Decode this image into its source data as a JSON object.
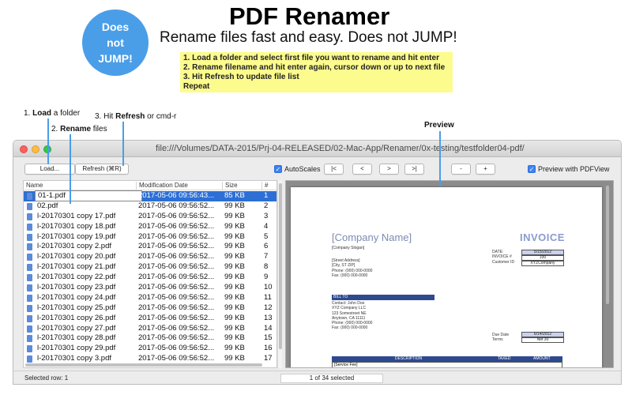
{
  "marketing": {
    "badge_lines": [
      "Does",
      "not",
      "JUMP!"
    ],
    "title": "PDF Renamer",
    "subtitle": "Rename files fast and easy. Does not JUMP!",
    "steps": [
      "1. Load a folder and select first file you want to rename and hit enter",
      "2. Rename filename and hit enter again, cursor down or up to next file",
      "3. Hit Refresh to update file list",
      "Repeat"
    ],
    "callouts": {
      "load_prefix": "1. ",
      "load_bold": "Load",
      "load_suffix": " a folder",
      "rename_prefix": "2. ",
      "rename_bold": "Rename",
      "rename_suffix": " files",
      "refresh_prefix": "3. Hit ",
      "refresh_bold": "Refresh",
      "refresh_suffix": " or cmd-r",
      "preview": "Preview"
    }
  },
  "window": {
    "title": "file:///Volumes/DATA-2015/Prj-04-RELEASED/02-Mac-App/Renamer/0x-testing/testfolder04-pdf/"
  },
  "toolbar": {
    "load_label": "Load...",
    "refresh_label": "Refresh (⌘R)",
    "autoscales_label": "AutoScales",
    "first_label": "|<",
    "prev_label": "<",
    "next_label": ">",
    "last_label": ">|",
    "zoom_out_label": "-",
    "zoom_in_label": "+",
    "preview_with_label": "Preview with PDFView"
  },
  "table": {
    "headers": {
      "name": "Name",
      "date": "Modification Date",
      "size": "Size",
      "num": "#"
    },
    "editing_value": "01-1.pdf",
    "rows": [
      {
        "name": "01-1.pdf",
        "date": "2017-05-06 09:56:43...",
        "size": "85 KB",
        "num": "1"
      },
      {
        "name": "02.pdf",
        "date": "2017-05-06 09:56:52...",
        "size": "99 KB",
        "num": "2"
      },
      {
        "name": "l-20170301 copy 17.pdf",
        "date": "2017-05-06 09:56:52...",
        "size": "99 KB",
        "num": "3"
      },
      {
        "name": "l-20170301 copy 18.pdf",
        "date": "2017-05-06 09:56:52...",
        "size": "99 KB",
        "num": "4"
      },
      {
        "name": "l-20170301 copy 19.pdf",
        "date": "2017-05-06 09:56:52...",
        "size": "99 KB",
        "num": "5"
      },
      {
        "name": "l-20170301 copy 2.pdf",
        "date": "2017-05-06 09:56:52...",
        "size": "99 KB",
        "num": "6"
      },
      {
        "name": "l-20170301 copy 20.pdf",
        "date": "2017-05-06 09:56:52...",
        "size": "99 KB",
        "num": "7"
      },
      {
        "name": "l-20170301 copy 21.pdf",
        "date": "2017-05-06 09:56:52...",
        "size": "99 KB",
        "num": "8"
      },
      {
        "name": "l-20170301 copy 22.pdf",
        "date": "2017-05-06 09:56:52...",
        "size": "99 KB",
        "num": "9"
      },
      {
        "name": "l-20170301 copy 23.pdf",
        "date": "2017-05-06 09:56:52...",
        "size": "99 KB",
        "num": "10"
      },
      {
        "name": "l-20170301 copy 24.pdf",
        "date": "2017-05-06 09:56:52...",
        "size": "99 KB",
        "num": "11"
      },
      {
        "name": "l-20170301 copy 25.pdf",
        "date": "2017-05-06 09:56:52...",
        "size": "99 KB",
        "num": "12"
      },
      {
        "name": "l-20170301 copy 26.pdf",
        "date": "2017-05-06 09:56:52...",
        "size": "99 KB",
        "num": "13"
      },
      {
        "name": "l-20170301 copy 27.pdf",
        "date": "2017-05-06 09:56:52...",
        "size": "99 KB",
        "num": "14"
      },
      {
        "name": "l-20170301 copy 28.pdf",
        "date": "2017-05-06 09:56:52...",
        "size": "99 KB",
        "num": "15"
      },
      {
        "name": "l-20170301 copy 29.pdf",
        "date": "2017-05-06 09:56:52...",
        "size": "99 KB",
        "num": "16"
      },
      {
        "name": "l-20170301 copy 3.pdf",
        "date": "2017-05-06 09:56:52...",
        "size": "99 KB",
        "num": "17"
      }
    ]
  },
  "preview": {
    "company": "[Company Name]",
    "invoice_title": "INVOICE",
    "slogan": "[Company Slogan]",
    "address_lines": [
      "[Street Address]",
      "[City, ST ZIP]",
      "Phone: (000) 000-0000",
      "Fax: (000) 000-0000"
    ],
    "meta_labels": [
      "DATE:",
      "INVOICE #",
      "Customer ID"
    ],
    "meta_values": [
      "5/15/2012",
      "100",
      "XYZCompany"
    ],
    "bill_to": "BILL TO",
    "bill_lines": [
      "Contact: John Doe",
      "XYZ Company LLC",
      "123 Somestreet NE",
      "Anytown, CA 11111",
      "Phone: (000) 000-0000",
      "Fax: (000) 000-0000"
    ],
    "due_labels": [
      "Due Date",
      "Terms"
    ],
    "due_values": [
      "6/14/2012",
      "Net 30"
    ],
    "desc_headers": [
      "DESCRIPTION",
      "TAXED",
      "AMOUNT"
    ],
    "first_item": "[Service Fee]"
  },
  "status": {
    "selected_row": "Selected row: 1",
    "count": "1 of 34 selected"
  },
  "colors": {
    "badge": "#4a9ee8",
    "note_bg": "#fcfb8e",
    "selection": "#2d6fd5",
    "invoice_accent": "#2e4a8f"
  }
}
